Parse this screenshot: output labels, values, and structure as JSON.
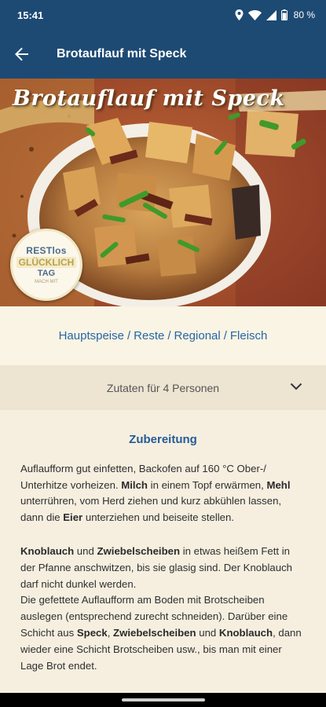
{
  "status_bar": {
    "time": "15:41",
    "battery": "80 %"
  },
  "app_bar": {
    "title": "Brotauflauf mit Speck",
    "back_icon": "arrow-left-icon"
  },
  "hero": {
    "title": "Brotauflauf mit Speck",
    "badge": {
      "line1": "RESTlos",
      "line2": "GLÜCKLICH",
      "line3": "TAG",
      "line4": "MACH MIT"
    }
  },
  "categories": [
    "Hauptspeise",
    "Reste",
    "Regional",
    "Fleisch"
  ],
  "ingredients": {
    "label": "Zutaten für 4 Personen",
    "expand_icon": "chevron-down-icon"
  },
  "preparation": {
    "heading": "Zubereitung",
    "p1": {
      "a": "Auflaufform gut einfetten, Backofen auf 160 °C Ober-/ Unterhitze vorheizen. ",
      "b": "Milch",
      "c": " in einem Topf erwärmen, ",
      "d": "Mehl",
      "e": " unterrühren, vom Herd ziehen und kurz abkühlen lassen, dann die ",
      "f": "Eier",
      "g": " unterziehen und beiseite stellen."
    },
    "p2": {
      "a": "Knoblauch",
      "b": " und ",
      "c": "Zwiebelscheiben",
      "d": " in etwas heißem Fett in der Pfanne anschwitzen, bis sie glasig sind. Der Knoblauch darf nicht dunkel werden.",
      "e": "Die gefettete Auflaufform am Boden mit Brotscheiben auslegen (entsprechend zurecht schneiden). Darüber eine Schicht aus ",
      "f": "Speck",
      "g": ", ",
      "h": "Zwiebelscheiben",
      "i": " und ",
      "j": "Knoblauch",
      "k": ", dann wieder eine Schicht Brotscheiben usw., bis man mit einer Lage Brot endet."
    }
  },
  "colors": {
    "primary": "#1d4a73",
    "link": "#2766a8",
    "background": "#f6efe0"
  }
}
